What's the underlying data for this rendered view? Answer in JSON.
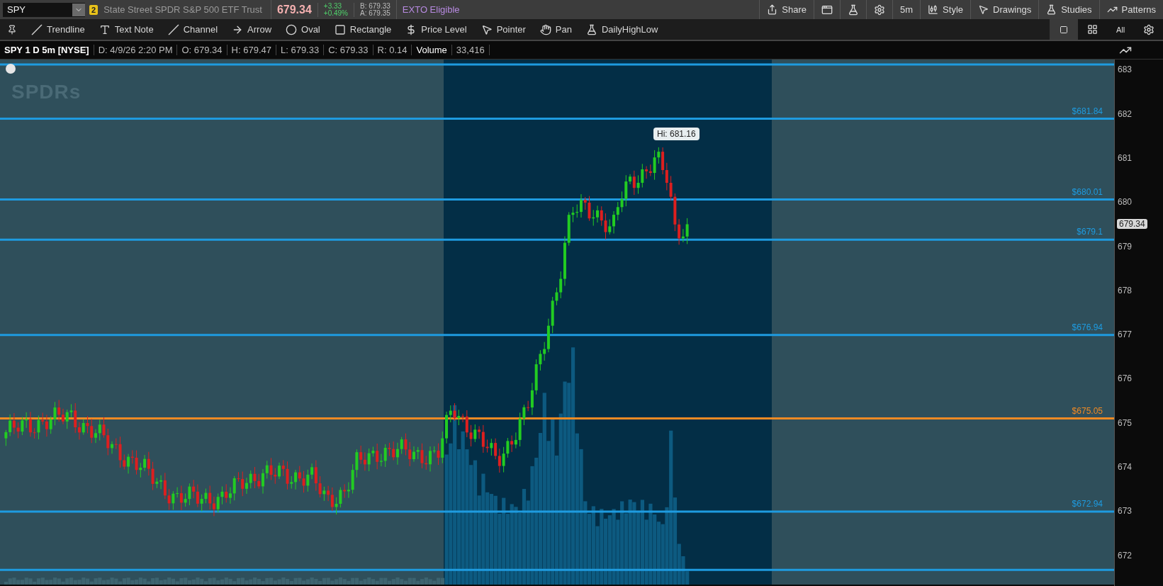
{
  "symbol_bar": {
    "symbol": "SPY",
    "link_badge": "2",
    "description": "State Street SPDR S&P 500 ETF Trust",
    "last_price": "679.34",
    "change": "+3.33",
    "change_percent": "+0.49%",
    "bid": "B: 679.33",
    "ask": "A: 679.35",
    "exto": "EXTO Eligible"
  },
  "chart_tools": [
    "Share",
    "5m",
    "Style",
    "Drawings",
    "Studies",
    "Patterns"
  ],
  "drawing_tools": [
    "Trendline",
    "Text Note",
    "Channel",
    "Arrow",
    "Oval",
    "Rectangle",
    "Price Level",
    "Pointer",
    "Pan",
    "DailyHighLow"
  ],
  "layout_buttons": [
    {
      "kind": "single",
      "selected": true
    },
    {
      "kind": "grid",
      "selected": false
    },
    {
      "kind": "text",
      "label": "All",
      "selected": false
    },
    {
      "kind": "gear",
      "selected": false
    }
  ],
  "info_bar": {
    "title": "SPY 1 D 5m [NYSE]",
    "fields": [
      "D: 4/9/26 2:20 PM",
      "O: 679.34",
      "H: 679.47",
      "L: 679.33",
      "C: 679.33",
      "R: 0.14"
    ],
    "volume_label": "Volume",
    "volume_value": "33,416"
  },
  "chart": {
    "logo_text": "SPDRs",
    "high_label": "Hi: 681.16",
    "last_price_badge": "679.34",
    "levels": [
      {
        "label": "$681.84",
        "color": "#1e9be0"
      },
      {
        "label": "$680.01",
        "color": "#1e9be0"
      },
      {
        "label": "$679.1",
        "color": "#1e9be0"
      },
      {
        "label": "$676.94",
        "color": "#1e9be0"
      },
      {
        "label": "$675.05",
        "color": "#f08a24"
      },
      {
        "label": "$672.94",
        "color": "#1e9be0"
      }
    ],
    "axis_ticks": [
      "683",
      "682",
      "681",
      "680",
      "679",
      "678",
      "677",
      "676",
      "675",
      "674",
      "673",
      "672"
    ]
  }
}
